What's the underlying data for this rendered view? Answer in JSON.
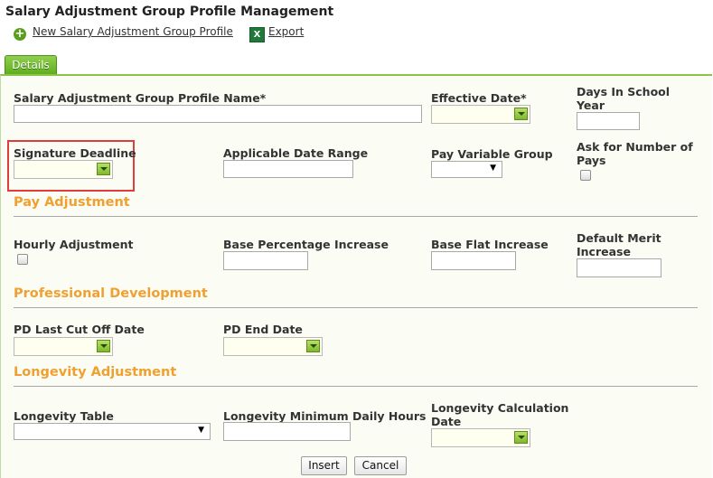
{
  "header": {
    "title": "Salary Adjustment Group Profile Management",
    "new_link": "New Salary Adjustment Group Profile",
    "export_link": "Export"
  },
  "tabs": {
    "details": "Details"
  },
  "fields": {
    "profile_name": "Salary Adjustment Group Profile Name*",
    "effective_date": "Effective Date*",
    "days_in_school_year": "Days In School Year",
    "signature_deadline": "Signature Deadline",
    "applicable_date_range": "Applicable Date Range",
    "pay_variable_group": "Pay Variable Group",
    "ask_number_of_pays": "Ask for Number of Pays",
    "hourly_adjustment": "Hourly Adjustment",
    "base_percentage_increase": "Base Percentage Increase",
    "base_flat_increase": "Base Flat Increase",
    "default_merit_increase": "Default Merit Increase",
    "pd_last_cut_off_date": "PD Last Cut Off Date",
    "pd_end_date": "PD End Date",
    "longevity_table": "Longevity Table",
    "longevity_min_daily_hours": "Longevity Minimum Daily Hours",
    "longevity_calc_date": "Longevity Calculation Date"
  },
  "sections": {
    "pay_adjustment": "Pay Adjustment",
    "professional_development": "Professional Development",
    "longevity_adjustment": "Longevity Adjustment"
  },
  "buttons": {
    "insert": "Insert",
    "cancel": "Cancel"
  },
  "colors": {
    "accent_green": "#6db52a",
    "section_orange": "#f0a030",
    "highlight_red": "#e03c3c"
  }
}
